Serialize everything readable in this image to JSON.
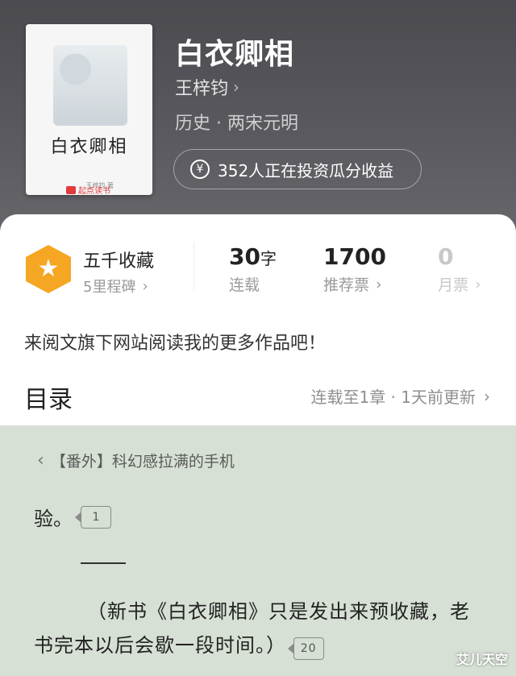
{
  "header": {
    "cover": {
      "title": "白衣卿相",
      "author": "王梓钧 著",
      "brand": "起点读书"
    },
    "book_title": "白衣卿相",
    "author": "王梓钧",
    "genre": "历史 · 两宋元明",
    "invest_text": "352人正在投资瓜分收益"
  },
  "stats": {
    "collect_title": "五千收藏",
    "collect_sub": "5里程碑",
    "words_num": "30",
    "words_unit": "字",
    "words_label": "连载",
    "recommend_num": "1700",
    "recommend_label": "推荐票",
    "monthly_num": "0",
    "monthly_label": "月票"
  },
  "promo": "来阅文旗下网站阅读我的更多作品吧！",
  "toc": {
    "title": "目录",
    "status": "连载至1章 · 1天前更新"
  },
  "reader": {
    "chapter": "【番外】科幻感拉满的手机",
    "line1": "验。",
    "line1_comments": "1",
    "para": "（新书《白衣卿相》只是发出来预收藏，老书完本以后会歇一段时间。）",
    "para_comments": "20"
  },
  "watermark": "艾儿天空",
  "colors": {
    "badge": "#f5a623",
    "reader_bg": "#d6e0d4",
    "header_bg": "#4a4a4f"
  }
}
